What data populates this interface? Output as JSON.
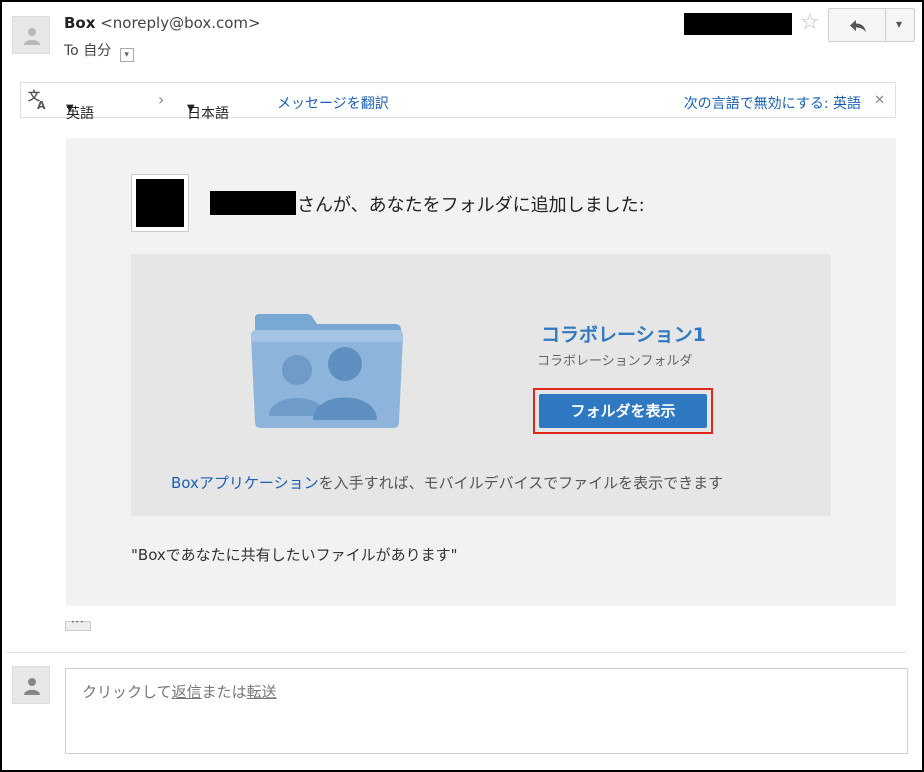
{
  "header": {
    "sender_name": "Box",
    "sender_email": "<noreply@box.com>",
    "to_label": "To 自分",
    "star_glyph": "☆",
    "reply_glyph": "↩",
    "more_glyph": "▾"
  },
  "translate_bar": {
    "source_lang": "英語",
    "arrow": "›",
    "target_lang": "日本語",
    "translate_link": "メッセージを翻訳",
    "disable_link": "次の言語で無効にする: 英語",
    "close_glyph": "✕"
  },
  "email": {
    "added_text": "さんが、あなたをフォルダに追加しました:",
    "folder_name": "コラボレーション1",
    "folder_type": "コラボレーションフォルダ",
    "view_button": "フォルダを表示",
    "app_link": "Boxアプリケーション",
    "app_text": "を入手すれば、モバイルデバイスでファイルを表示できます",
    "quote": "\"Boxであなたに共有したいファイルがあります\""
  },
  "trimmed_glyph": "•••",
  "reply": {
    "prefix": "クリックして",
    "reply_link": "返信",
    "middle": "または",
    "forward_link": "転送"
  },
  "colors": {
    "button_blue": "#2f79c2",
    "link_blue": "#1a5fb4",
    "highlight_red": "#e0261a",
    "folder_blue": "#8db5dc"
  }
}
